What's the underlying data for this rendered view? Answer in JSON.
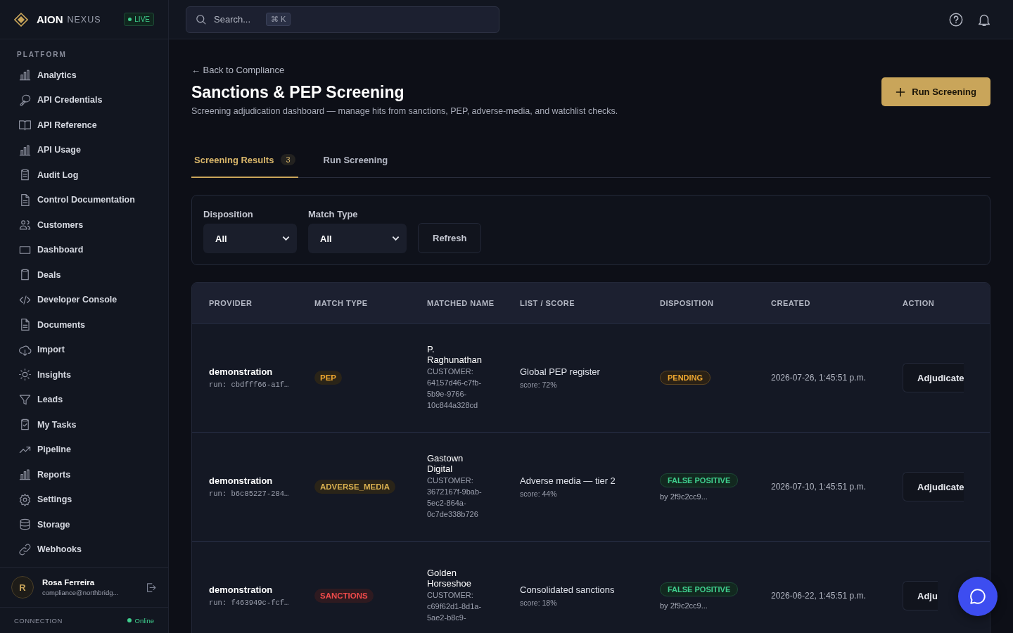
{
  "brand": {
    "name": "AION",
    "suffix": "NEXUS",
    "status": "LIVE"
  },
  "search": {
    "placeholder": "Search...",
    "shortcut": "⌘ K"
  },
  "sidebar": {
    "section": "PLATFORM",
    "items": [
      {
        "label": "Analytics",
        "selected": false
      },
      {
        "label": "API Credentials",
        "selected": false
      },
      {
        "label": "API Reference",
        "selected": false
      },
      {
        "label": "API Usage",
        "selected": false
      },
      {
        "label": "Audit Log",
        "selected": false
      },
      {
        "label": "Control Documentation",
        "selected": false
      },
      {
        "label": "Customers",
        "selected": false
      },
      {
        "label": "Dashboard",
        "selected": false
      },
      {
        "label": "Deals",
        "selected": false
      },
      {
        "label": "Developer Console",
        "selected": false
      },
      {
        "label": "Documents",
        "selected": false
      },
      {
        "label": "Import",
        "selected": false
      },
      {
        "label": "Insights",
        "selected": false
      },
      {
        "label": "Leads",
        "selected": false
      },
      {
        "label": "My Tasks",
        "selected": false
      },
      {
        "label": "Pipeline",
        "selected": false
      },
      {
        "label": "Reports",
        "selected": false
      },
      {
        "label": "Settings",
        "selected": false
      },
      {
        "label": "Storage",
        "selected": false
      },
      {
        "label": "Webhooks",
        "selected": false
      }
    ],
    "user": {
      "initial": "R",
      "name": "Rosa Ferreira",
      "email": "compliance@northbridg..."
    },
    "connection": {
      "label": "CONNECTION",
      "status": "Online"
    }
  },
  "page": {
    "back": "← Back to Compliance",
    "title": "Sanctions & PEP Screening",
    "subtitle": "Screening adjudication dashboard — manage hits from sanctions, PEP, adverse-media, and watchlist checks.",
    "primary_button": "Run Screening"
  },
  "tabs": [
    {
      "label": "Screening Results",
      "count": "3",
      "selected": true
    },
    {
      "label": "Run Screening",
      "selected": false
    }
  ],
  "filters": [
    {
      "label": "Disposition",
      "value": "All"
    },
    {
      "label": "Match Type",
      "value": "All"
    }
  ],
  "refresh_button": "Refresh",
  "table": {
    "columns": [
      "PROVIDER",
      "MATCH TYPE",
      "MATCHED NAME",
      "LIST / SCORE",
      "DISPOSITION",
      "CREATED",
      "ACTION"
    ],
    "rows": [
      {
        "provider": "demonstration",
        "run": "run: cbdfff66-a1f…",
        "match_type": {
          "label": "PEP",
          "kind": "pep"
        },
        "name": "P. Raghunathan",
        "customer": "CUSTOMER: 64157d46-c7fb-5b9e-9766-10c844a328cd",
        "list": "Global PEP register",
        "score": "score: 72%",
        "disposition": {
          "label": "PENDING",
          "kind": "pending"
        },
        "created": "2026-07-26, 1:45:51 p.m.",
        "action": "Adjudicate"
      },
      {
        "provider": "demonstration",
        "run": "run: b6c85227-284…",
        "match_type": {
          "label": "ADVERSE_MEDIA",
          "kind": "adverse_media"
        },
        "name": "Gastown Digital",
        "customer": "CUSTOMER: 3672167f-9bab-5ec2-864a-0c7de338b726",
        "list": "Adverse media — tier 2",
        "score": "score: 44%",
        "disposition": {
          "label": "FALSE POSITIVE",
          "kind": "false_positive",
          "by": "by 2f9c2cc9..."
        },
        "created": "2026-07-10, 1:45:51 p.m.",
        "action": "Adjudicate"
      },
      {
        "provider": "demonstration",
        "run": "run: f463949c-fcf…",
        "match_type": {
          "label": "SANCTIONS",
          "kind": "sanctions"
        },
        "name": "Golden Horseshoe",
        "customer": "CUSTOMER: c69f62d1-8d1a-5ae2-b8c9-",
        "list": "Consolidated sanctions",
        "score": "score: 18%",
        "disposition": {
          "label": "FALSE POSITIVE",
          "kind": "false_positive",
          "by": "by 2f9c2cc9..."
        },
        "created": "2026-06-22, 1:45:51 p.m.",
        "action": "Adju"
      }
    ]
  }
}
